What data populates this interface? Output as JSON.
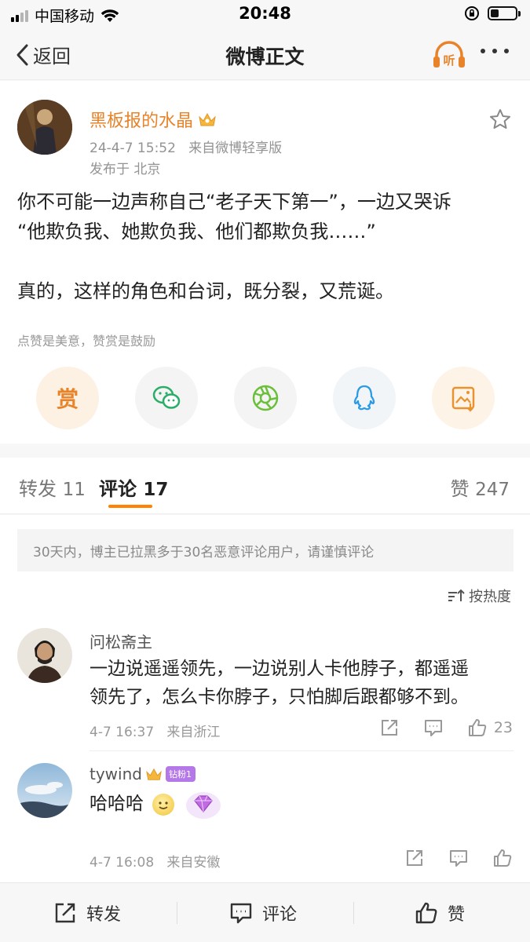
{
  "status_bar": {
    "carrier": "中国移动",
    "time": "20:48"
  },
  "nav": {
    "back_label": "返回",
    "title": "微博正文",
    "listen_label": "听"
  },
  "post": {
    "author": "黑板报的水晶",
    "timestamp": "24-4-7 15:52",
    "source": "来自微博轻享版",
    "location": "发布于 北京",
    "lines": [
      "你不可能一边声称自己“老子天下第一”，一边又哭诉",
      "“他欺负我、她欺负我、他们都欺负我……”",
      "真的，这样的角色和台词，既分裂，又荒诞。"
    ],
    "reward_hint": "点赞是美意，赞赏是鼓励",
    "reward_label": "赏"
  },
  "tabs": {
    "repost": {
      "label": "转发",
      "count": "11"
    },
    "comment": {
      "label": "评论",
      "count": "17"
    },
    "like": {
      "label": "赞",
      "count": "247"
    }
  },
  "notice": "30天内，博主已拉黑多于30名恶意评论用户，请谨慎评论",
  "sort_label": "按热度",
  "comments": [
    {
      "user": "问松斋主",
      "lines": [
        "一边说遥遥领先，一边说别人卡他脖子，都遥遥",
        "领先了，怎么卡你脖子，只怕脚后跟都够不到。"
      ],
      "time": "4-7 16:37",
      "source": "来自浙江",
      "likes": "23"
    },
    {
      "user": "tywind",
      "badge": "钻粉1",
      "text": "哈哈哈",
      "time": "4-7 16:08",
      "source": "来自安徽"
    }
  ],
  "bottom_bar": {
    "repost": "转发",
    "comment": "评论",
    "like": "赞"
  },
  "colors": {
    "accent": "#ff8200",
    "username": "#e8832a",
    "fan_badge": "#b478e8"
  }
}
